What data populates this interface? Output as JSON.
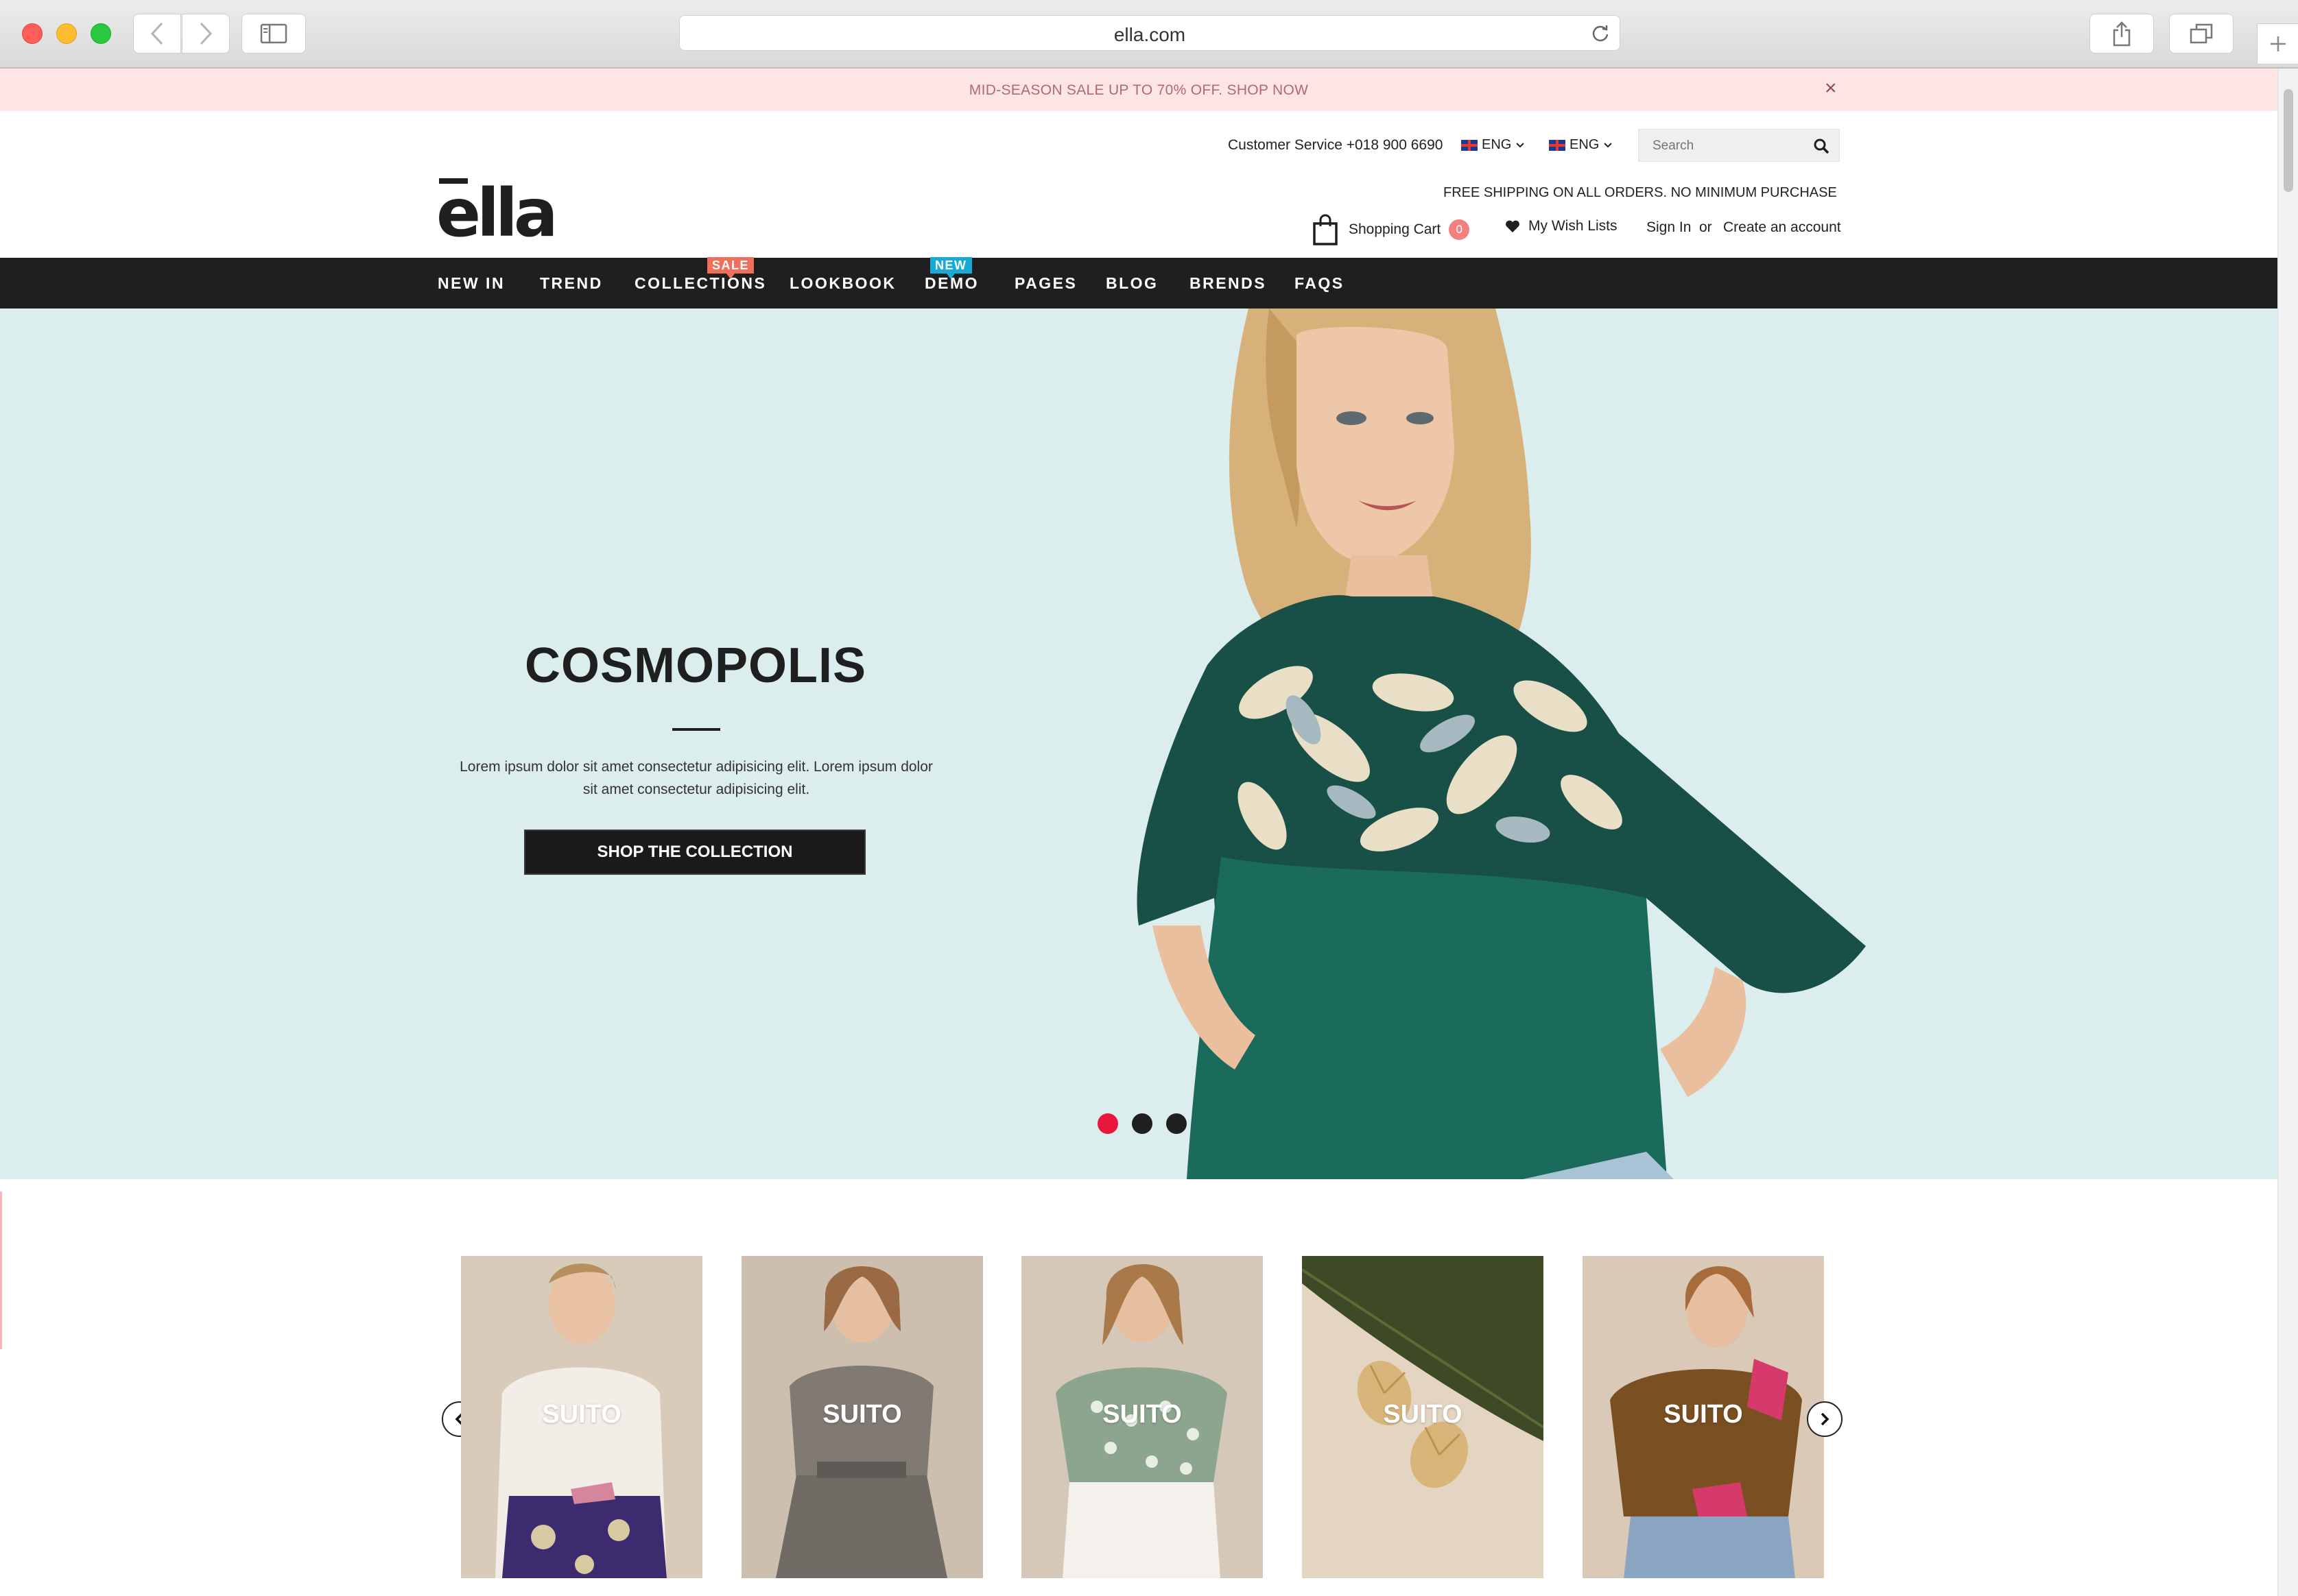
{
  "browser": {
    "url": "ella.com",
    "icons": {
      "back": "chevron-left-icon",
      "forward": "chevron-right-icon",
      "sidebar": "sidebar-icon",
      "reload": "reload-icon",
      "share": "share-icon",
      "tabs": "tabs-icon",
      "new_tab": "plus-icon"
    }
  },
  "announcement": {
    "text": "MID-SEASON SALE UP TO 70% OFF. SHOP NOW",
    "close": "×",
    "background": "#fde5e6"
  },
  "header": {
    "customer_service": "Customer Service +018 900 6690",
    "language_1": "ENG",
    "language_2": "ENG",
    "search_placeholder": "Search",
    "logo": "ella",
    "free_shipping": "FREE SHIPPING ON ALL ORDERS. NO MINIMUM PURCHASE",
    "cart_label": "Shopping Cart",
    "cart_count": "0",
    "wishlist_label": "My Wish Lists",
    "sign_in": "Sign In",
    "or": "or",
    "create_account": "Create an account"
  },
  "nav": {
    "items": [
      {
        "label": "NEW IN"
      },
      {
        "label": "TREND"
      },
      {
        "label": "COLLECTIONS",
        "badge": "SALE"
      },
      {
        "label": "LOOKBOOK"
      },
      {
        "label": "DEMO",
        "badge": "NEW"
      },
      {
        "label": "PAGES"
      },
      {
        "label": "BLOG"
      },
      {
        "label": "BRENDS"
      },
      {
        "label": "FAQS"
      }
    ],
    "colors": {
      "bar": "#1f1f1f",
      "sale_badge": "#ef6f5b",
      "new_badge": "#17a9d8"
    }
  },
  "hero": {
    "title": "COSMOPOLIS",
    "text": "Lorem ipsum dolor sit amet consectetur adipisicing elit. Lorem ipsum dolor sit amet consectetur adipisicing elit.",
    "button": "SHOP THE COLLECTION",
    "active_slide": 1,
    "slide_count": 3,
    "colors": {
      "background": "#dcedee",
      "active_dot": "#e8173c"
    }
  },
  "categories": {
    "cards": [
      {
        "label": "SUITO"
      },
      {
        "label": "SUITO"
      },
      {
        "label": "SUITO"
      },
      {
        "label": "SUITO"
      },
      {
        "label": "SUITO"
      }
    ],
    "icons": {
      "prev": "chevron-left-icon",
      "next": "chevron-right-icon"
    }
  }
}
